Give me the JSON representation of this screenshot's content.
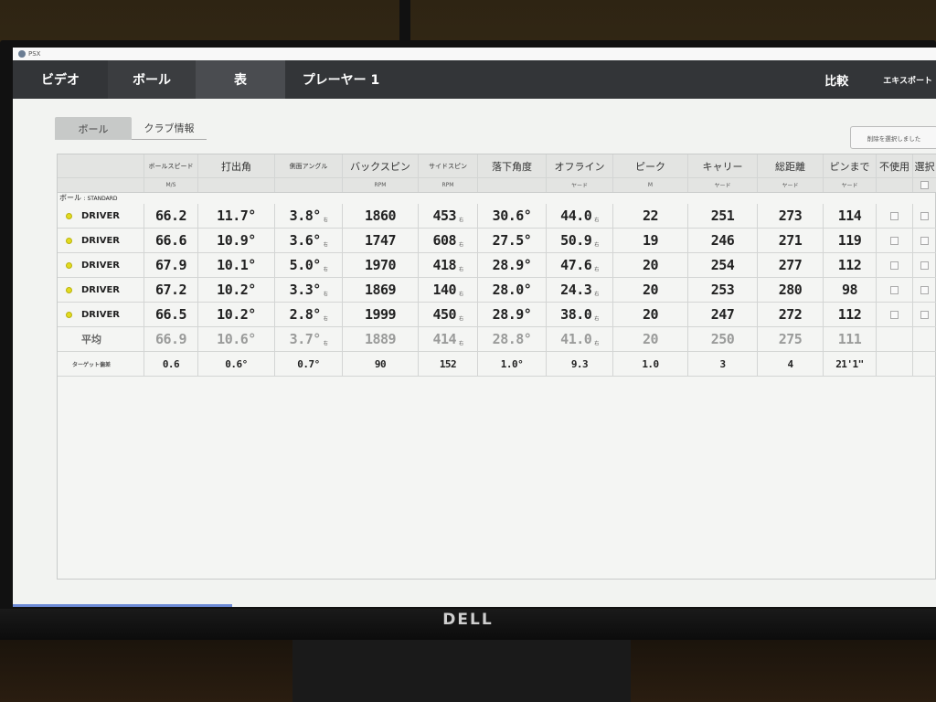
{
  "window": {
    "title": "PSX"
  },
  "nav": {
    "tabs": [
      "ビデオ",
      "ボール",
      "表",
      "プレーヤー 1"
    ],
    "compare": "比較",
    "export": "エキスポート"
  },
  "subtabs": [
    "ボール",
    "クラブ情報"
  ],
  "delete_button": "削除を選択しました",
  "table": {
    "headers": [
      "ボールスピード",
      "打出角",
      "側面アングル",
      "バックスピン",
      "サイドスピン",
      "落下角度",
      "オフライン",
      "ピーク",
      "キャリー",
      "総距離",
      "ピンまで",
      "不使用",
      "選択"
    ],
    "units": [
      "M/S",
      "",
      "",
      "RPM",
      "RPM",
      "",
      "ヤード",
      "M",
      "ヤード",
      "ヤード",
      "ヤード",
      "",
      ""
    ],
    "group_label": "ボール",
    "group_sub": ": STANDARD",
    "rows": [
      {
        "club": "DRIVER",
        "values": [
          "66.2",
          "11.7°",
          "3.8°",
          "1860",
          "453",
          "30.6°",
          "44.0",
          "22",
          "251",
          "273",
          "114"
        ]
      },
      {
        "club": "DRIVER",
        "values": [
          "66.6",
          "10.9°",
          "3.6°",
          "1747",
          "608",
          "27.5°",
          "50.9",
          "19",
          "246",
          "271",
          "119"
        ]
      },
      {
        "club": "DRIVER",
        "values": [
          "67.9",
          "10.1°",
          "5.0°",
          "1970",
          "418",
          "28.9°",
          "47.6",
          "20",
          "254",
          "277",
          "112"
        ]
      },
      {
        "club": "DRIVER",
        "values": [
          "67.2",
          "10.2°",
          "3.3°",
          "1869",
          "140",
          "28.0°",
          "24.3",
          "20",
          "253",
          "280",
          "98"
        ]
      },
      {
        "club": "DRIVER",
        "values": [
          "66.5",
          "10.2°",
          "2.8°",
          "1999",
          "450",
          "28.9°",
          "38.0",
          "20",
          "247",
          "272",
          "112"
        ]
      }
    ],
    "direction_mark": "右",
    "average": {
      "label": "平均",
      "values": [
        "66.9",
        "10.6°",
        "3.7°",
        "1889",
        "414",
        "28.8°",
        "41.0",
        "20",
        "250",
        "275",
        "111"
      ]
    },
    "target": {
      "label": "ターゲット偏差",
      "values": [
        "0.6",
        "0.6°",
        "0.7°",
        "90",
        "152",
        "1.0°",
        "9.3",
        "1.0",
        "3",
        "4",
        "21'1\""
      ]
    }
  },
  "monitor_brand": "DELL",
  "colors": {
    "shot_dot": "#e3db1f",
    "nav_bg": "#333538",
    "average_text": "#9a9b9a"
  }
}
